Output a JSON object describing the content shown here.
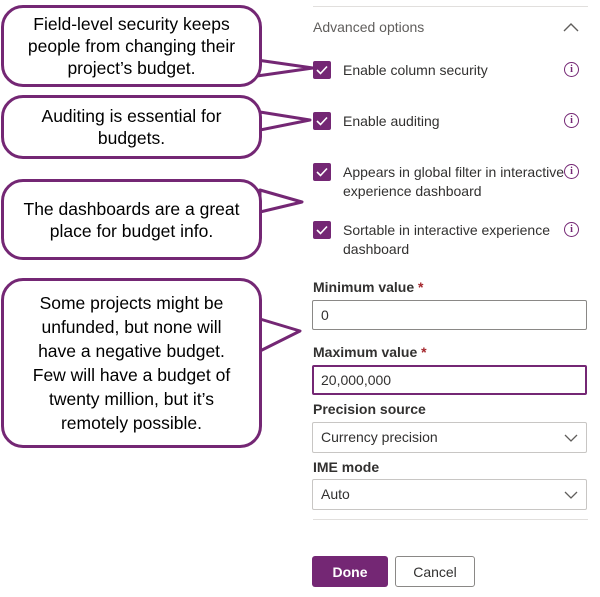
{
  "panel": {
    "section_title": "Advanced options",
    "checkboxes": [
      {
        "label": "Enable column security",
        "checked": true
      },
      {
        "label": "Enable auditing",
        "checked": true
      },
      {
        "label_line1": "Appears in global filter in interactive",
        "label_line2": "experience dashboard",
        "checked": true
      },
      {
        "label_line1": "Sortable in interactive experience",
        "label_line2": "dashboard",
        "checked": true
      }
    ],
    "minimum_value": {
      "label": "Minimum value",
      "required_mark": "*",
      "value": "0"
    },
    "maximum_value": {
      "label": "Maximum value",
      "required_mark": "*",
      "value": "20,000,000"
    },
    "precision_source": {
      "label": "Precision source",
      "selected": "Currency precision"
    },
    "ime_mode": {
      "label": "IME mode",
      "selected": "Auto"
    },
    "done_label": "Done",
    "cancel_label": "Cancel",
    "accent_color": "#742774"
  },
  "callouts": [
    {
      "line1": "Field-level security keeps",
      "line2": "people from changing their",
      "line3": "project’s  budget."
    },
    {
      "line1": "Auditing is essential for",
      "line2": "budgets."
    },
    {
      "line1": "The dashboards are a great",
      "line2": "place for budget info."
    },
    {
      "line1": "Some projects might be",
      "line2": "unfunded, but none will",
      "line3": "have a negative budget.",
      "line4": "Few will have a budget of",
      "line5": "twenty million, but it’s",
      "line6": "remotely possible."
    }
  ]
}
